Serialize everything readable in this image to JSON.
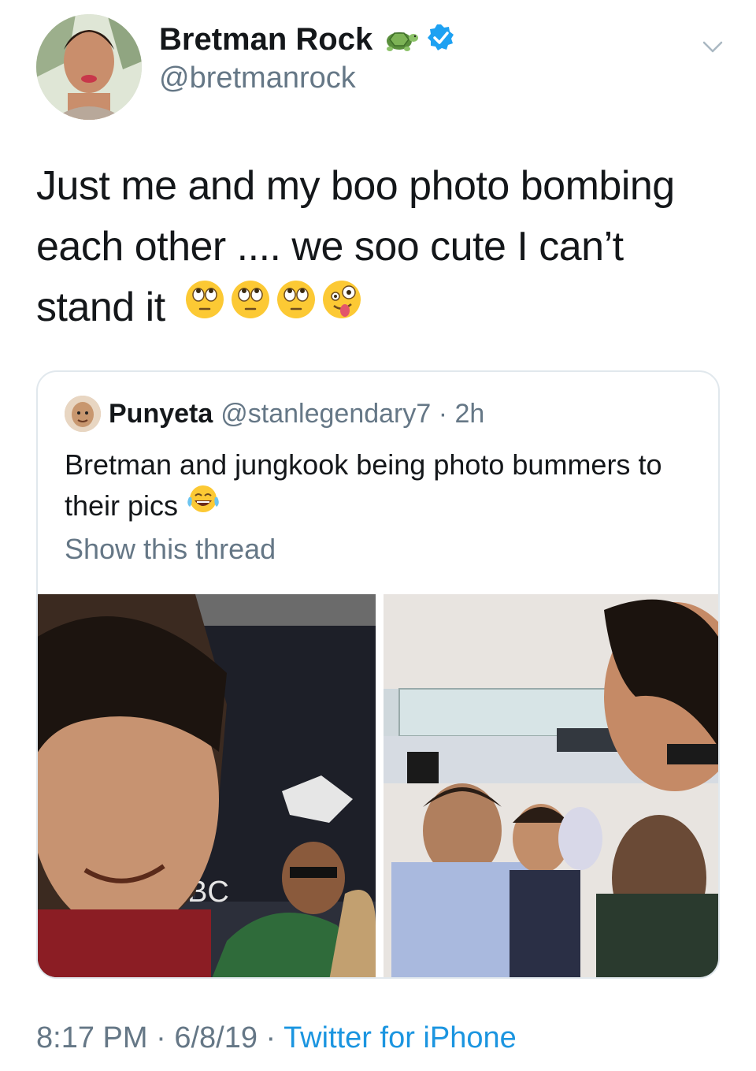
{
  "author": {
    "display_name": "Bretman Rock",
    "handle": "@bretmanrock",
    "badge_icon": "turtle-icon",
    "verified": true
  },
  "tweet": {
    "text": "Just me and my boo photo bombing each other .... we soo cute I can’t stand it",
    "emojis": [
      "rolling-eyes-icon",
      "rolling-eyes-icon",
      "rolling-eyes-icon",
      "zany-face-icon"
    ]
  },
  "quoted": {
    "display_name": "Punyeta",
    "handle_time": "@stanlegendary7 · 2h",
    "text": "Bretman and jungkook being photo bummers to their pics",
    "text_emoji": "tears-of-joy-icon",
    "show_thread": "Show this thread",
    "photos": [
      "photo-left",
      "photo-right"
    ]
  },
  "meta": {
    "time": "8:17 PM",
    "sep1": " · ",
    "date": "6/8/19",
    "sep2": " · ",
    "source": "Twitter for iPhone"
  },
  "colors": {
    "link": "#1b95e0",
    "secondary": "#657786",
    "border": "#e1e8ed",
    "verified": "#1da1f2"
  }
}
